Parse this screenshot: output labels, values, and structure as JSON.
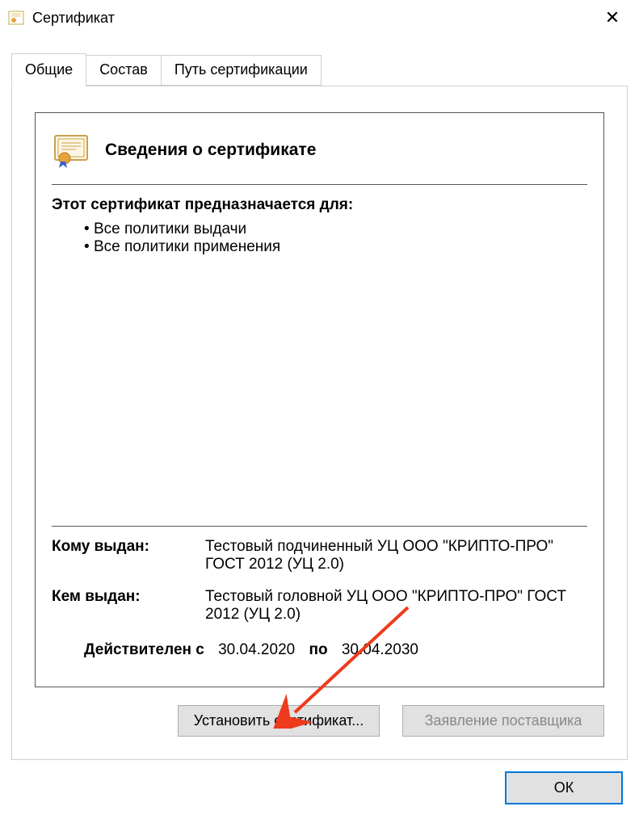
{
  "window": {
    "title": "Сертификат"
  },
  "tabs": [
    {
      "label": "Общие",
      "active": true
    },
    {
      "label": "Состав",
      "active": false
    },
    {
      "label": "Путь сертификации",
      "active": false
    }
  ],
  "cert": {
    "heading": "Сведения о сертификате",
    "purpose_title": "Этот сертификат предназначается для:",
    "purposes": [
      "Все политики выдачи",
      "Все политики применения"
    ],
    "issued_to_label": "Кому выдан:",
    "issued_to": "Тестовый подчиненный УЦ ООО \"КРИПТО-ПРО\" ГОСТ 2012 (УЦ 2.0)",
    "issued_by_label": "Кем выдан:",
    "issued_by": "Тестовый головной УЦ ООО \"КРИПТО-ПРО\" ГОСТ 2012 (УЦ 2.0)",
    "valid_label": "Действителен с",
    "valid_from": "30.04.2020",
    "valid_sep": "по",
    "valid_to": "30.04.2030"
  },
  "buttons": {
    "install": "Установить сертификат...",
    "vendor": "Заявление поставщика",
    "ok": "ОК"
  }
}
